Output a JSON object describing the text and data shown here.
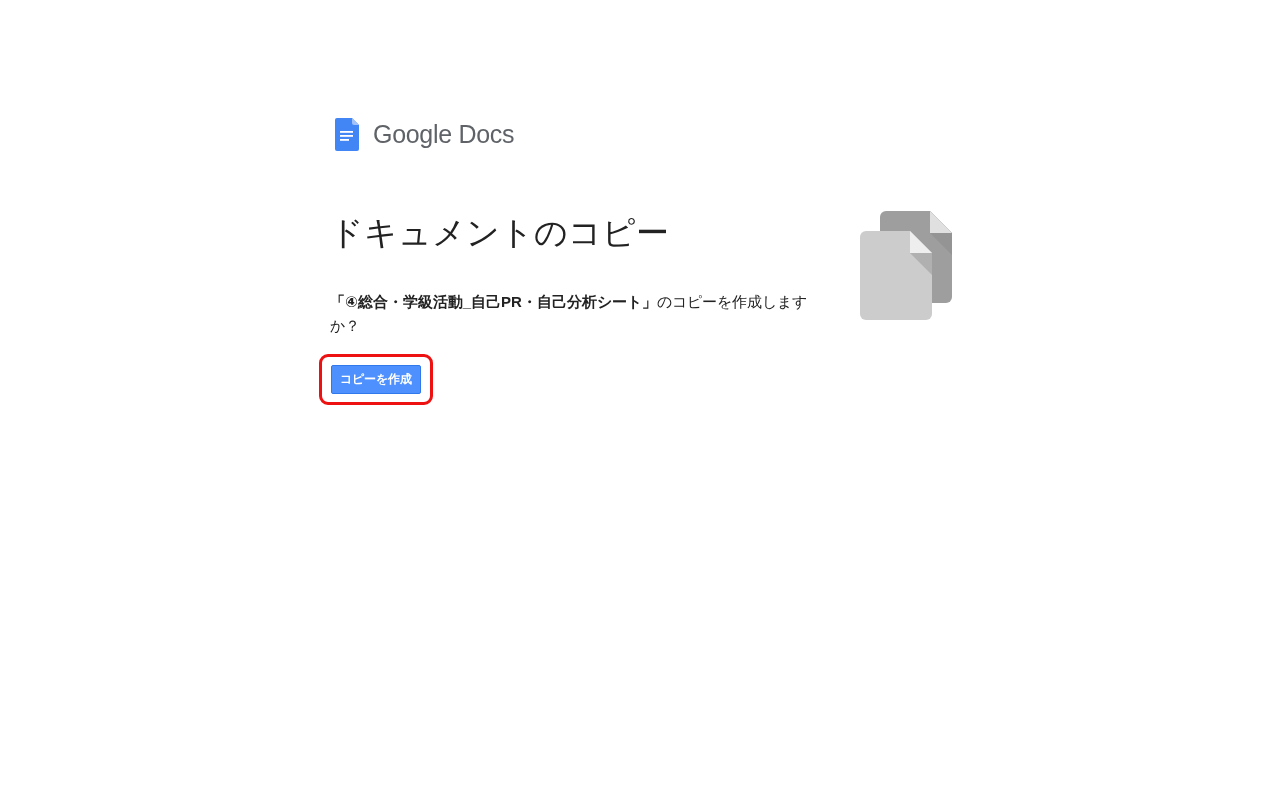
{
  "logo": {
    "text": "Google Docs"
  },
  "title": "ドキュメントのコピー",
  "message": "**「④総合・学級活動_自己PR・自己分析シート」**のコピーを作成しますか？",
  "button": {
    "label": "コピーを作成",
    "highlighted": true
  }
}
